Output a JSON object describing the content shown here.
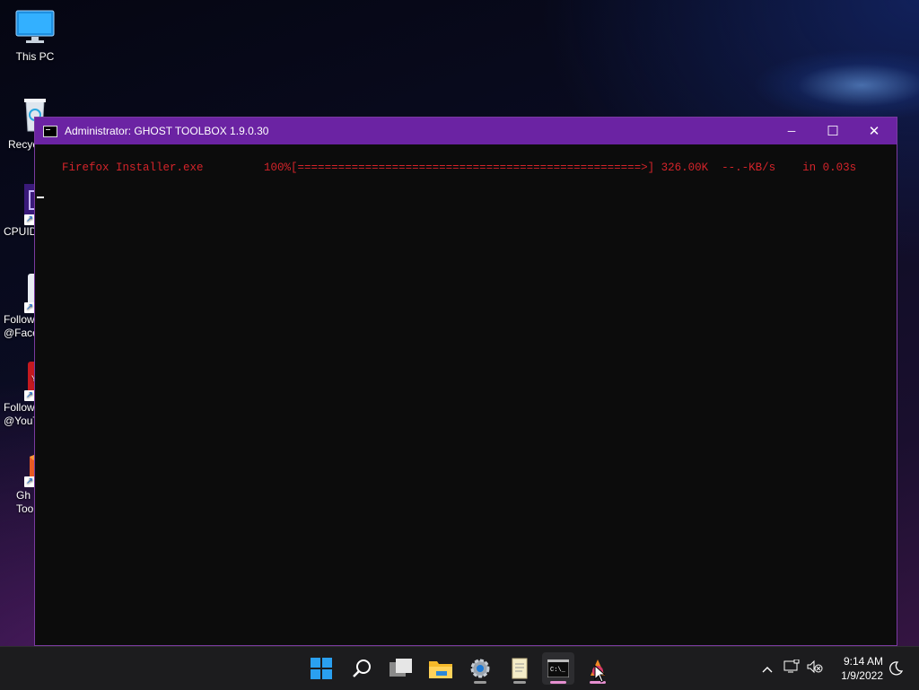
{
  "desktop": {
    "icons": [
      {
        "label": "This PC"
      },
      {
        "label": "Recyc"
      },
      {
        "label": "CPUID"
      },
      {
        "label": "Follow\n@Face"
      },
      {
        "label": "Follow\n@YouT"
      },
      {
        "label": "Gh\nToo"
      }
    ]
  },
  "window": {
    "title": "Administrator:  GHOST TOOLBOX 1.9.0.30",
    "minimize_glyph": "─",
    "maximize_glyph": "☐",
    "close_glyph": "✕",
    "console_line": "Firefox Installer.exe         100%[===================================================>] 326.00K  --.-KB/s    in 0.03s",
    "text_color": "#d4242a",
    "titlebar_color": "#6b23a3"
  },
  "taskbar": {
    "apps": [
      {
        "name": "start-icon"
      },
      {
        "name": "search-icon"
      },
      {
        "name": "task-view-icon"
      },
      {
        "name": "file-explorer-icon"
      },
      {
        "name": "settings-icon"
      },
      {
        "name": "notepad-icon"
      },
      {
        "name": "terminal-icon"
      },
      {
        "name": "ghost-toolbox-icon"
      }
    ],
    "tray": {
      "chevron": "^",
      "time": "9:14 AM",
      "date": "1/9/2022"
    }
  }
}
